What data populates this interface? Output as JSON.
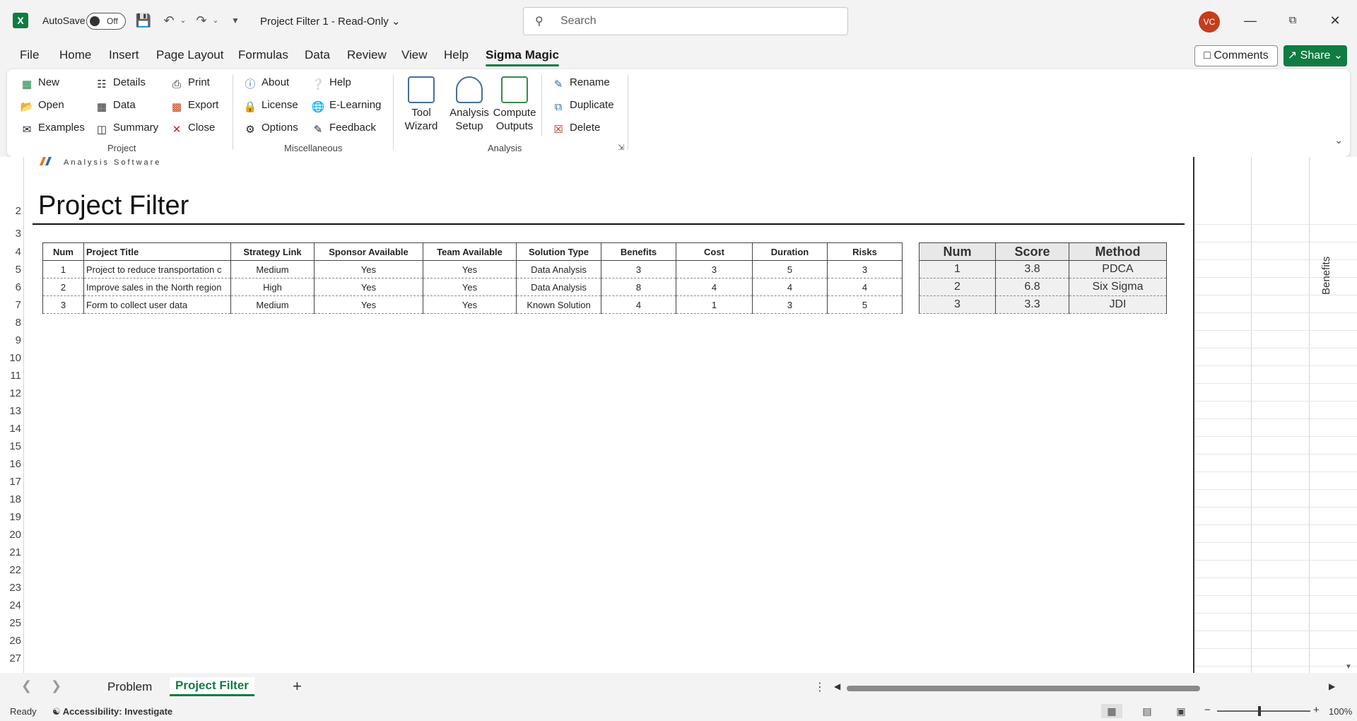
{
  "titlebar": {
    "autosave_label": "AutoSave",
    "autosave_state": "Off",
    "doc_title": "Project Filter 1  -  Read-Only",
    "search_placeholder": "Search",
    "avatar_initials": "VC"
  },
  "tabs": [
    "File",
    "Home",
    "Insert",
    "Page Layout",
    "Formulas",
    "Data",
    "Review",
    "View",
    "Help",
    "Sigma Magic"
  ],
  "active_tab": "Sigma Magic",
  "comments_label": "Comments",
  "share_label": "Share",
  "ribbon": {
    "project": {
      "label": "Project",
      "items": [
        "New",
        "Open",
        "Examples",
        "Details",
        "Data",
        "Summary",
        "Print",
        "Export",
        "Close"
      ]
    },
    "misc": {
      "label": "Miscellaneous",
      "items": [
        "About",
        "License",
        "Options",
        "Help",
        "E-Learning",
        "Feedback"
      ]
    },
    "analysis": {
      "label": "Analysis",
      "tool_wizard": [
        "Tool",
        "Wizard"
      ],
      "analysis_setup": [
        "Analysis",
        "Setup"
      ],
      "compute_outputs": [
        "Compute",
        "Outputs"
      ],
      "items": [
        "Rename",
        "Duplicate",
        "Delete"
      ]
    }
  },
  "sheet": {
    "logo_tagline": "Analysis Software",
    "title": "Project Filter",
    "row_numbers": [
      "2",
      "3",
      "4",
      "5",
      "6",
      "7",
      "8",
      "9",
      "10",
      "11",
      "12",
      "13",
      "14",
      "15",
      "16",
      "17",
      "18",
      "19",
      "20",
      "21",
      "22",
      "23",
      "24",
      "25",
      "26",
      "27"
    ],
    "project_table": {
      "headers": [
        "Num",
        "Project Title",
        "Strategy Link",
        "Sponsor Available",
        "Team Available",
        "Solution Type",
        "Benefits",
        "Cost",
        "Duration",
        "Risks"
      ],
      "rows": [
        [
          "1",
          "Project to reduce transportation c",
          "Medium",
          "Yes",
          "Yes",
          "Data Analysis",
          "3",
          "3",
          "5",
          "3"
        ],
        [
          "2",
          "Improve sales in the North region",
          "High",
          "Yes",
          "Yes",
          "Data Analysis",
          "8",
          "4",
          "4",
          "4"
        ],
        [
          "3",
          "Form to collect user data",
          "Medium",
          "Yes",
          "Yes",
          "Known Solution",
          "4",
          "1",
          "3",
          "5"
        ]
      ]
    },
    "score_table": {
      "headers": [
        "Num",
        "Score",
        "Method"
      ],
      "rows": [
        [
          "1",
          "3.8",
          "PDCA"
        ],
        [
          "2",
          "6.8",
          "Six Sigma"
        ],
        [
          "3",
          "3.3",
          "JDI"
        ]
      ]
    },
    "side_label": "Benefits"
  },
  "sheet_tabs": [
    "Problem",
    "Project Filter"
  ],
  "active_sheet": "Project Filter",
  "status": {
    "ready": "Ready",
    "accessibility": "Accessibility: Investigate",
    "zoom": "100%"
  },
  "colors": {
    "accent": "#107c41",
    "avatar": "#c43e1c"
  }
}
